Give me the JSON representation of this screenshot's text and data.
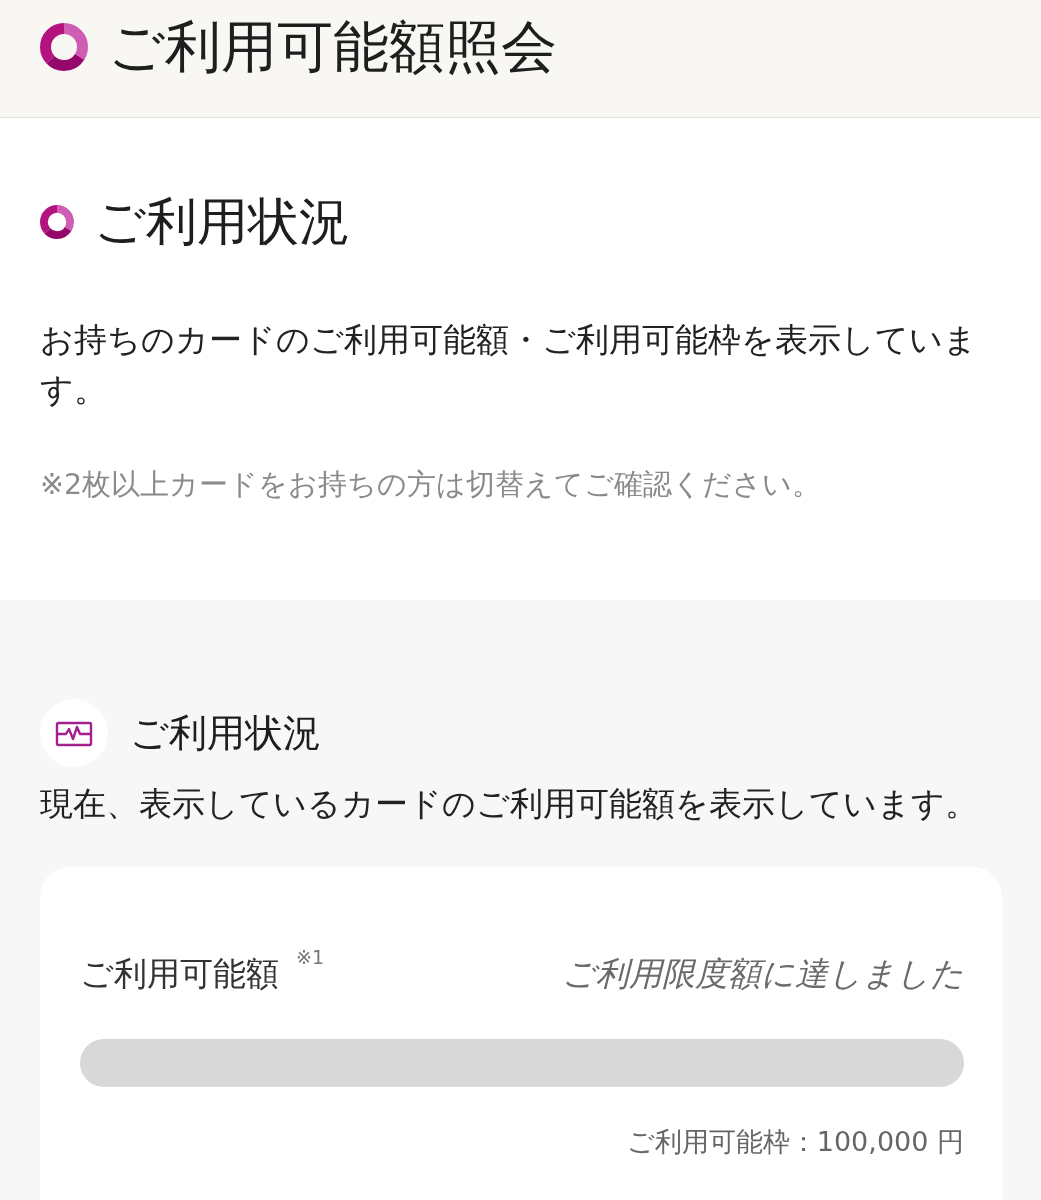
{
  "header": {
    "title": "ご利用可能額照会"
  },
  "usage_section": {
    "heading": "ご利用状況",
    "description": "お持ちのカードのご利用可能額・ご利用可能枠を表示しています。",
    "note": "※2枚以上カードをお持ちの方は切替えてご確認ください。"
  },
  "usage_panel": {
    "heading": "ご利用状況",
    "description": "現在、表示しているカードのご利用可能額を表示しています。",
    "card": {
      "label": "ご利用可能額",
      "footnote_mark": "※1",
      "status": "ご利用限度額に達しました",
      "level": 0,
      "limit": "ご利用可能枠：100,000 円"
    }
  }
}
